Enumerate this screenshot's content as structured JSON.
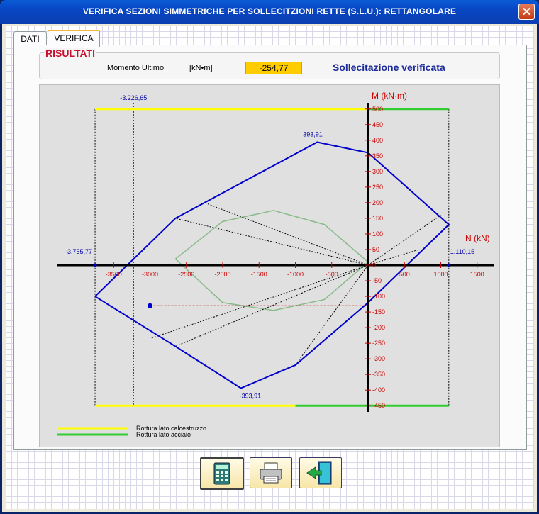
{
  "window": {
    "title": "VERIFICA SEZIONI SIMMETRICHE PER SOLLECITZIONI RETTE (S.L.U.): RETTANGOLARE"
  },
  "tabs": [
    {
      "label": "DATI"
    },
    {
      "label": "VERIFICA"
    }
  ],
  "results": {
    "group_title": "RISULTATI",
    "moment_label": "Momento Ultimo",
    "unit": "[kN•m]",
    "value": "-254,77",
    "status": "Sollecitazione verificata"
  },
  "chart_data": {
    "type": "line",
    "x_axis_label": "N (kN)",
    "y_axis_label": "M (kN·m)",
    "x_ticks": [
      -3500,
      -3000,
      -2500,
      -2000,
      -1500,
      -1000,
      -500,
      500,
      1000,
      1500
    ],
    "x_tick_labels": [
      "-3500",
      "-3000",
      "-2500",
      "-2000",
      "-1500",
      "-1000",
      "-500",
      "500",
      "1000",
      "1500"
    ],
    "y_ticks": [
      500,
      450,
      400,
      350,
      300,
      250,
      200,
      150,
      100,
      50,
      0,
      -50,
      -100,
      -150,
      -200,
      -250,
      -300,
      -350,
      -400,
      -450
    ],
    "y_tick_labels": [
      "500",
      "450",
      "400",
      "350",
      "300",
      "250",
      "200",
      "150",
      "100",
      "50",
      "0",
      "-50",
      "-100",
      "-150",
      "-200",
      "-250",
      "-300",
      "-350",
      "-400",
      "-450"
    ],
    "xlim": [
      -4000,
      1700
    ],
    "ylim": [
      -470,
      520
    ],
    "annotations": {
      "n_min": {
        "value": -3755.77,
        "label": "-3.755,77"
      },
      "n_max": {
        "value": 1110.15,
        "label": "1.110,15"
      },
      "m_max": {
        "value": 393.91,
        "label": "393,91",
        "at_n": -700
      },
      "m_min": {
        "value": -393.91,
        "label": "-393,91",
        "at_n": -1750
      },
      "n_design": {
        "value": -3226.65,
        "label": "-3.226,65"
      }
    },
    "design_point": {
      "N": -3000,
      "M": -130
    },
    "domain_outer": [
      {
        "N": -3755.77,
        "M": -100
      },
      {
        "N": -2650,
        "M": 150
      },
      {
        "N": -700,
        "M": 393.91
      },
      {
        "N": 0,
        "M": 360
      },
      {
        "N": 1110.15,
        "M": 130
      },
      {
        "N": 0,
        "M": -120
      },
      {
        "N": -1000,
        "M": -320
      },
      {
        "N": -1750,
        "M": -393.91
      },
      {
        "N": -2650,
        "M": -260
      },
      {
        "N": -3755.77,
        "M": -100
      }
    ],
    "domain_inner": [
      {
        "N": -2650,
        "M": 20
      },
      {
        "N": -2000,
        "M": 140
      },
      {
        "N": -1300,
        "M": 175
      },
      {
        "N": -600,
        "M": 130
      },
      {
        "N": 0,
        "M": 10
      },
      {
        "N": -600,
        "M": -110
      },
      {
        "N": -1300,
        "M": -145
      },
      {
        "N": -2000,
        "M": -120
      },
      {
        "N": -2650,
        "M": 20
      }
    ],
    "legend": [
      {
        "label": "Rottura lato calcestruzzo",
        "color": "#ffff00"
      },
      {
        "label": "Rottura lato acciaio",
        "color": "#33cc33"
      }
    ],
    "colors": {
      "domain": "#0000cc",
      "inner": "#88bb88",
      "axes": "#000000",
      "ticks": "#cc0000",
      "tick_labels": "#cc0000"
    }
  },
  "buttons": [
    {
      "name": "calculate",
      "icon": "calculator-icon"
    },
    {
      "name": "print",
      "icon": "printer-icon"
    },
    {
      "name": "exit",
      "icon": "exit-door-icon"
    }
  ]
}
